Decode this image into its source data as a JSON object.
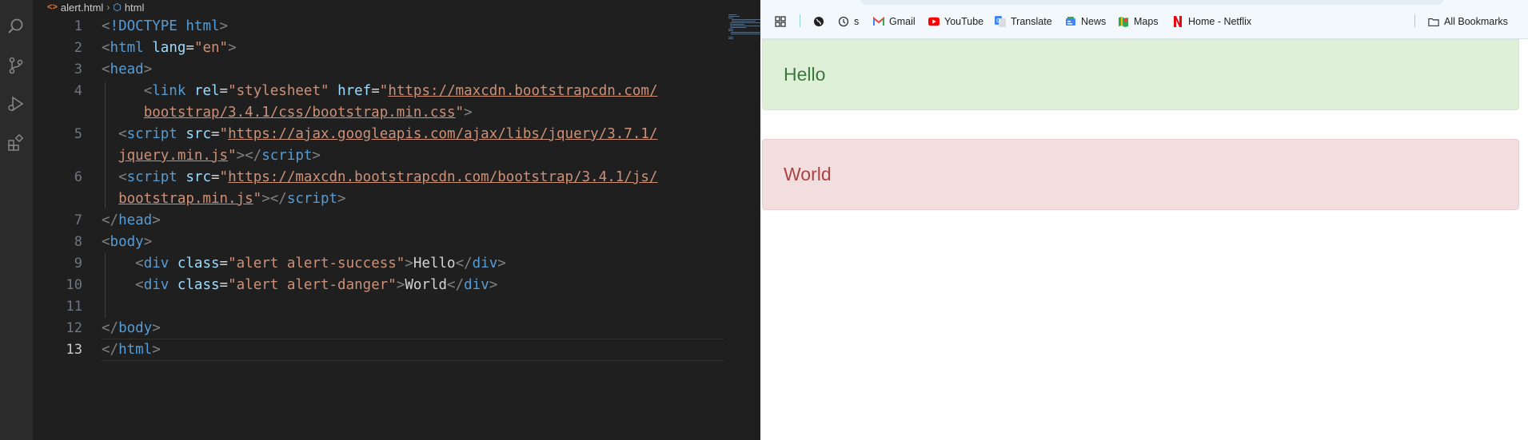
{
  "editor": {
    "breadcrumb": {
      "file": "alert.html",
      "element": "html"
    },
    "line_numbers": [
      "1",
      "2",
      "3",
      "4",
      "5",
      "6",
      "7",
      "8",
      "9",
      "10",
      "11",
      "12",
      "13"
    ],
    "lines": [
      {
        "id": "l1",
        "tokens": [
          [
            "punc",
            "<"
          ],
          [
            "kw",
            "!DOCTYPE"
          ],
          [
            "text",
            " "
          ],
          [
            "tag",
            "html"
          ],
          [
            "punc",
            ">"
          ]
        ]
      },
      {
        "id": "l2",
        "tokens": [
          [
            "punc",
            "<"
          ],
          [
            "tag",
            "html"
          ],
          [
            "text",
            " "
          ],
          [
            "attr",
            "lang"
          ],
          [
            "text",
            "="
          ],
          [
            "str",
            "\"en\""
          ],
          [
            "punc",
            ">"
          ]
        ]
      },
      {
        "id": "l3",
        "tokens": [
          [
            "punc",
            "<"
          ],
          [
            "tag",
            "head"
          ],
          [
            "punc",
            ">"
          ]
        ]
      },
      {
        "id": "l4a",
        "tokens": [
          [
            "text",
            "     "
          ],
          [
            "punc",
            "<"
          ],
          [
            "tag",
            "link"
          ],
          [
            "text",
            " "
          ],
          [
            "attr",
            "rel"
          ],
          [
            "text",
            "="
          ],
          [
            "str",
            "\"stylesheet\""
          ],
          [
            "text",
            " "
          ],
          [
            "attr",
            "href"
          ],
          [
            "text",
            "="
          ],
          [
            "str",
            "\""
          ],
          [
            "link",
            "https://maxcdn.bootstrapcdn.com/"
          ]
        ]
      },
      {
        "id": "l4b",
        "tokens": [
          [
            "text",
            "     "
          ],
          [
            "link",
            "bootstrap/3.4.1/css/bootstrap.min.css"
          ],
          [
            "str",
            "\""
          ],
          [
            "punc",
            ">"
          ]
        ]
      },
      {
        "id": "l5a",
        "tokens": [
          [
            "text",
            "  "
          ],
          [
            "punc",
            "<"
          ],
          [
            "tag",
            "script"
          ],
          [
            "text",
            " "
          ],
          [
            "attr",
            "src"
          ],
          [
            "text",
            "="
          ],
          [
            "str",
            "\""
          ],
          [
            "link",
            "https://ajax.googleapis.com/ajax/libs/jquery/3.7.1/"
          ]
        ]
      },
      {
        "id": "l5b",
        "tokens": [
          [
            "text",
            "  "
          ],
          [
            "link",
            "jquery.min.js"
          ],
          [
            "str",
            "\""
          ],
          [
            "punc",
            "></"
          ],
          [
            "tag",
            "script"
          ],
          [
            "punc",
            ">"
          ]
        ]
      },
      {
        "id": "l6a",
        "tokens": [
          [
            "text",
            "  "
          ],
          [
            "punc",
            "<"
          ],
          [
            "tag",
            "script"
          ],
          [
            "text",
            " "
          ],
          [
            "attr",
            "src"
          ],
          [
            "text",
            "="
          ],
          [
            "str",
            "\""
          ],
          [
            "link",
            "https://maxcdn.bootstrapcdn.com/bootstrap/3.4.1/js/"
          ]
        ]
      },
      {
        "id": "l6b",
        "tokens": [
          [
            "text",
            "  "
          ],
          [
            "link",
            "bootstrap.min.js"
          ],
          [
            "str",
            "\""
          ],
          [
            "punc",
            "></"
          ],
          [
            "tag",
            "script"
          ],
          [
            "punc",
            ">"
          ]
        ]
      },
      {
        "id": "l7",
        "tokens": [
          [
            "punc",
            "</"
          ],
          [
            "tag",
            "head"
          ],
          [
            "punc",
            ">"
          ]
        ]
      },
      {
        "id": "l8",
        "tokens": [
          [
            "punc",
            "<"
          ],
          [
            "tag",
            "body"
          ],
          [
            "punc",
            ">"
          ]
        ]
      },
      {
        "id": "l9",
        "tokens": [
          [
            "text",
            "    "
          ],
          [
            "punc",
            "<"
          ],
          [
            "tag",
            "div"
          ],
          [
            "text",
            " "
          ],
          [
            "attr",
            "class"
          ],
          [
            "text",
            "="
          ],
          [
            "str",
            "\"alert alert-success\""
          ],
          [
            "punc",
            ">"
          ],
          [
            "text",
            "Hello"
          ],
          [
            "punc",
            "</"
          ],
          [
            "tag",
            "div"
          ],
          [
            "punc",
            ">"
          ]
        ]
      },
      {
        "id": "l10",
        "tokens": [
          [
            "text",
            "    "
          ],
          [
            "punc",
            "<"
          ],
          [
            "tag",
            "div"
          ],
          [
            "text",
            " "
          ],
          [
            "attr",
            "class"
          ],
          [
            "text",
            "="
          ],
          [
            "str",
            "\"alert alert-danger\""
          ],
          [
            "punc",
            ">"
          ],
          [
            "text",
            "World"
          ],
          [
            "punc",
            "</"
          ],
          [
            "tag",
            "div"
          ],
          [
            "punc",
            ">"
          ]
        ]
      },
      {
        "id": "l11",
        "tokens": []
      },
      {
        "id": "l12",
        "tokens": [
          [
            "punc",
            "</"
          ],
          [
            "tag",
            "body"
          ],
          [
            "punc",
            ">"
          ]
        ]
      },
      {
        "id": "l13",
        "tokens": [
          [
            "punc",
            "</"
          ],
          [
            "tag",
            "html"
          ],
          [
            "punc",
            ">"
          ]
        ]
      }
    ],
    "activity_icons": [
      "search-icon",
      "source-control-icon",
      "run-debug-icon",
      "extensions-icon"
    ]
  },
  "browser": {
    "bookmarks": [
      {
        "id": "apps",
        "label": "",
        "icon": "apps-grid-icon"
      },
      {
        "id": "globe",
        "label": "",
        "icon": "globe-icon"
      },
      {
        "id": "history",
        "label": "s",
        "icon": "history-icon"
      },
      {
        "id": "gmail",
        "label": "Gmail",
        "icon": "gmail-icon"
      },
      {
        "id": "youtube",
        "label": "YouTube",
        "icon": "youtube-icon"
      },
      {
        "id": "translate",
        "label": "Translate",
        "icon": "translate-icon"
      },
      {
        "id": "news",
        "label": "News",
        "icon": "news-icon"
      },
      {
        "id": "maps",
        "label": "Maps",
        "icon": "maps-icon"
      },
      {
        "id": "netflix",
        "label": "Home - Netflix",
        "icon": "netflix-icon"
      },
      {
        "id": "all",
        "label": "All Bookmarks",
        "icon": "folder-icon"
      }
    ],
    "alerts": {
      "success": "Hello",
      "danger": "World"
    },
    "colors": {
      "success_bg": "#dff0d8",
      "success_text": "#3c763d",
      "danger_bg": "#f2dede",
      "danger_text": "#a94442"
    }
  }
}
